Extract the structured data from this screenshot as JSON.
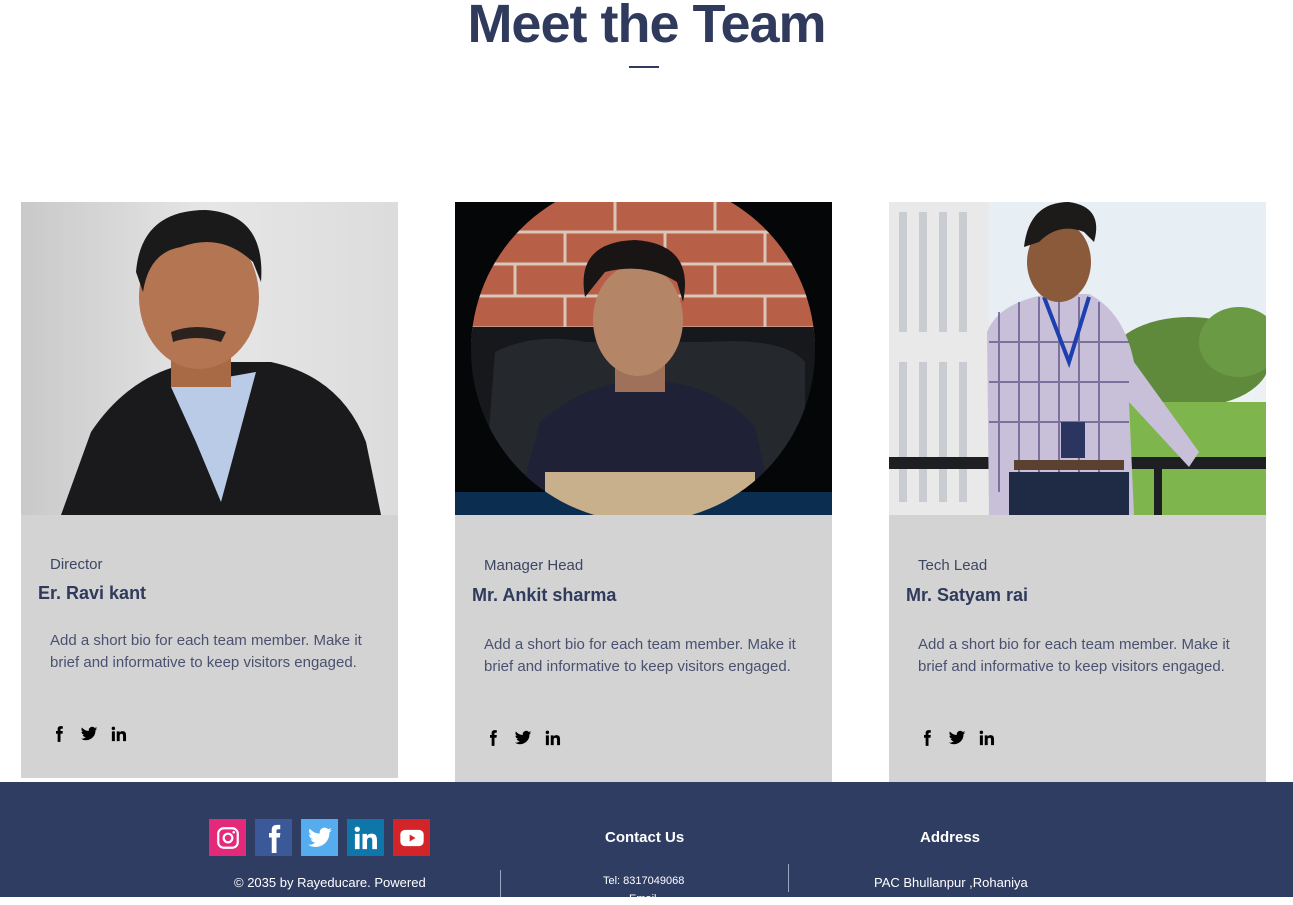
{
  "header": {
    "title": "Meet the Team"
  },
  "team": [
    {
      "role": "Director",
      "name": "Er. Ravi kant",
      "bio": "Add a short bio for each team member. Make it brief and informative to keep visitors engaged."
    },
    {
      "role": "Manager Head",
      "name": "Mr. Ankit sharma",
      "bio": "Add a short bio for each team member. Make it brief and informative to keep visitors engaged."
    },
    {
      "role": "Tech Lead",
      "name": "Mr. Satyam rai",
      "bio": "Add a short bio for each team member. Make it brief and informative to keep visitors engaged."
    }
  ],
  "card_social_icons": [
    "facebook-icon",
    "twitter-icon",
    "linkedin-icon"
  ],
  "footer": {
    "social_icons": [
      "instagram-icon",
      "facebook-icon",
      "twitter-icon",
      "linkedin-icon",
      "youtube-icon"
    ],
    "copyright": "© 2035 by Rayeducare. Powered",
    "contact_heading": "Contact Us",
    "tel": "Tel: 8317049068",
    "email_partial": "Email",
    "address_heading": "Address",
    "address_line1": "PAC Bhullanpur ,Rohaniya"
  },
  "colors": {
    "title": "#2f3a5c",
    "card_bg": "#d3d3d3",
    "footer_bg": "#2f3d63",
    "instagram": "#e4287a",
    "facebook": "#3b5998",
    "twitter": "#55acee",
    "linkedin": "#0e76a8",
    "youtube": "#d3242a"
  }
}
